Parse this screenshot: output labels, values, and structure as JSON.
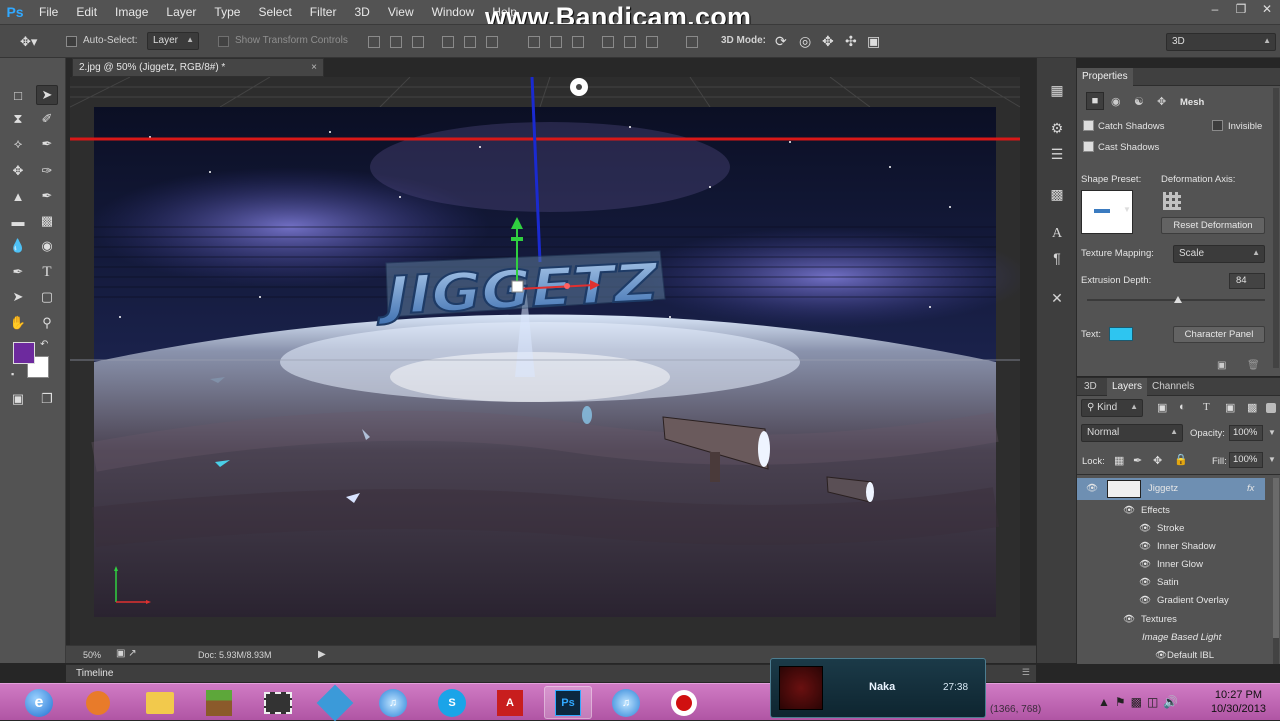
{
  "app": {
    "logo": "Ps",
    "watermark": "www.Bandicam.com"
  },
  "menu": [
    "File",
    "Edit",
    "Image",
    "Layer",
    "Type",
    "Select",
    "Filter",
    "3D",
    "View",
    "Window",
    "Help"
  ],
  "options_bar": {
    "auto_select_label": "Auto-Select:",
    "auto_select_value": "Layer",
    "show_transform_label": "Show Transform Controls",
    "mode_3d_label": "3D Mode:",
    "workspace_value": "3D"
  },
  "document": {
    "tab_title": "2.jpg @ 50% (Jiggetz, RGB/8#) *",
    "zoom": "50%",
    "doc_size": "Doc: 5.93M/8.93M",
    "logo_text": "JIGGETZ"
  },
  "timeline_label": "Timeline",
  "properties": {
    "title": "Properties",
    "mesh_label": "Mesh",
    "catch_shadows": "Catch Shadows",
    "invisible": "Invisible",
    "cast_shadows": "Cast Shadows",
    "shape_preset_label": "Shape Preset:",
    "deformation_axis_label": "Deformation Axis:",
    "reset_deformation": "Reset Deformation",
    "texture_mapping_label": "Texture Mapping:",
    "texture_mapping_value": "Scale",
    "extrusion_depth_label": "Extrusion Depth:",
    "extrusion_depth_value": "84",
    "text_label": "Text:",
    "text_color": "#2ec5f0",
    "character_panel": "Character Panel"
  },
  "layers_panel": {
    "tabs": [
      "3D",
      "Layers",
      "Channels"
    ],
    "kind_label": "Kind",
    "blend_mode": "Normal",
    "opacity_label": "Opacity:",
    "opacity_value": "100%",
    "lock_label": "Lock:",
    "fill_label": "Fill:",
    "fill_value": "100%",
    "layer_name": "Jiggetz",
    "effects_label": "Effects",
    "effects": [
      "Stroke",
      "Inner Shadow",
      "Inner Glow",
      "Satin",
      "Gradient Overlay"
    ],
    "textures_label": "Textures",
    "ibl_label": "Image Based Light",
    "default_ibl": "Default IBL"
  },
  "popup": {
    "title": "Naka",
    "time": "27:38"
  },
  "status_coords": "(1366, 768)",
  "tray": {
    "time": "10:27 PM",
    "date": "10/30/2013"
  },
  "colors": {
    "foreground": "#6d2a9e",
    "background": "#ffffff",
    "taskbar": "#c46ab8"
  }
}
